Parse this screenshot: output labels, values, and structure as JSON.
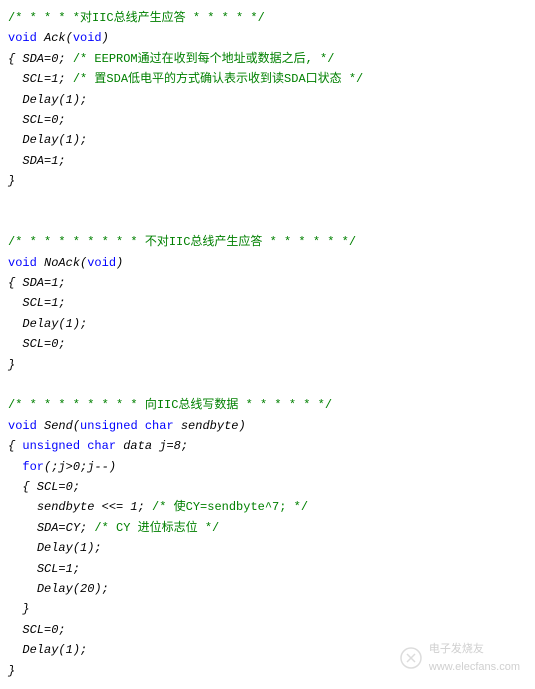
{
  "lines": [
    {
      "indent": 0,
      "parts": [
        {
          "t": "comment",
          "v": "/* * * * *对IIC总线产生应答 * * * * */"
        }
      ]
    },
    {
      "indent": 0,
      "parts": [
        {
          "t": "keyword",
          "v": "void"
        },
        {
          "t": "text",
          "v": " Ack("
        },
        {
          "t": "keyword",
          "v": "void"
        },
        {
          "t": "text",
          "v": ")"
        }
      ]
    },
    {
      "indent": 0,
      "parts": [
        {
          "t": "text",
          "v": "{ SDA=0; "
        },
        {
          "t": "comment",
          "v": "/* EEPROM通过在收到每个地址或数据之后, */"
        }
      ]
    },
    {
      "indent": 1,
      "parts": [
        {
          "t": "text",
          "v": "SCL=1; "
        },
        {
          "t": "comment",
          "v": "/* 置SDA低电平的方式确认表示收到读SDA口状态 */"
        }
      ]
    },
    {
      "indent": 1,
      "parts": [
        {
          "t": "text",
          "v": "Delay(1);"
        }
      ]
    },
    {
      "indent": 1,
      "parts": [
        {
          "t": "text",
          "v": "SCL=0;"
        }
      ]
    },
    {
      "indent": 1,
      "parts": [
        {
          "t": "text",
          "v": "Delay(1);"
        }
      ]
    },
    {
      "indent": 1,
      "parts": [
        {
          "t": "text",
          "v": "SDA=1;"
        }
      ]
    },
    {
      "indent": 0,
      "parts": [
        {
          "t": "text",
          "v": "}"
        }
      ]
    },
    {
      "indent": 0,
      "parts": []
    },
    {
      "indent": 0,
      "parts": []
    },
    {
      "indent": 0,
      "parts": [
        {
          "t": "comment",
          "v": "/* * * * * * * * * 不对IIC总线产生应答 * * * * * */"
        }
      ]
    },
    {
      "indent": 0,
      "parts": [
        {
          "t": "keyword",
          "v": "void"
        },
        {
          "t": "text",
          "v": " NoAck("
        },
        {
          "t": "keyword",
          "v": "void"
        },
        {
          "t": "text",
          "v": ")"
        }
      ]
    },
    {
      "indent": 0,
      "parts": [
        {
          "t": "text",
          "v": "{ SDA=1;"
        }
      ]
    },
    {
      "indent": 1,
      "parts": [
        {
          "t": "text",
          "v": "SCL=1;"
        }
      ]
    },
    {
      "indent": 1,
      "parts": [
        {
          "t": "text",
          "v": "Delay(1);"
        }
      ]
    },
    {
      "indent": 1,
      "parts": [
        {
          "t": "text",
          "v": "SCL=0;"
        }
      ]
    },
    {
      "indent": 0,
      "parts": [
        {
          "t": "text",
          "v": "}"
        }
      ]
    },
    {
      "indent": 0,
      "parts": []
    },
    {
      "indent": 0,
      "parts": [
        {
          "t": "comment",
          "v": "/* * * * * * * * * 向IIC总线写数据 * * * * * */"
        }
      ]
    },
    {
      "indent": 0,
      "parts": [
        {
          "t": "keyword",
          "v": "void"
        },
        {
          "t": "text",
          "v": " Send("
        },
        {
          "t": "keyword",
          "v": "unsigned"
        },
        {
          "t": "text",
          "v": " "
        },
        {
          "t": "keyword",
          "v": "char"
        },
        {
          "t": "text",
          "v": " sendbyte)"
        }
      ]
    },
    {
      "indent": 0,
      "parts": [
        {
          "t": "text",
          "v": "{ "
        },
        {
          "t": "keyword",
          "v": "unsigned"
        },
        {
          "t": "text",
          "v": " "
        },
        {
          "t": "keyword",
          "v": "char"
        },
        {
          "t": "text",
          "v": " data j=8;"
        }
      ]
    },
    {
      "indent": 1,
      "parts": [
        {
          "t": "keyword",
          "v": "for"
        },
        {
          "t": "text",
          "v": "(;j>0;j--)"
        }
      ]
    },
    {
      "indent": 1,
      "parts": [
        {
          "t": "text",
          "v": "{ SCL=0;"
        }
      ]
    },
    {
      "indent": 2,
      "parts": [
        {
          "t": "text",
          "v": "sendbyte <<= 1; "
        },
        {
          "t": "comment",
          "v": "/* 使CY=sendbyte^7; */"
        }
      ]
    },
    {
      "indent": 2,
      "parts": [
        {
          "t": "text",
          "v": "SDA=CY; "
        },
        {
          "t": "comment",
          "v": "/* CY 进位标志位 */"
        }
      ]
    },
    {
      "indent": 2,
      "parts": [
        {
          "t": "text",
          "v": "Delay(1);"
        }
      ]
    },
    {
      "indent": 2,
      "parts": [
        {
          "t": "text",
          "v": "SCL=1;"
        }
      ]
    },
    {
      "indent": 2,
      "parts": [
        {
          "t": "text",
          "v": "Delay(20);"
        }
      ]
    },
    {
      "indent": 1,
      "parts": [
        {
          "t": "text",
          "v": "}"
        }
      ]
    },
    {
      "indent": 1,
      "parts": [
        {
          "t": "text",
          "v": "SCL=0;"
        }
      ]
    },
    {
      "indent": 1,
      "parts": [
        {
          "t": "text",
          "v": "Delay(1);"
        }
      ]
    },
    {
      "indent": 0,
      "parts": [
        {
          "t": "text",
          "v": "}"
        }
      ]
    }
  ],
  "watermark": {
    "text1": "电子发烧友",
    "text2": "www.elecfans.com"
  }
}
